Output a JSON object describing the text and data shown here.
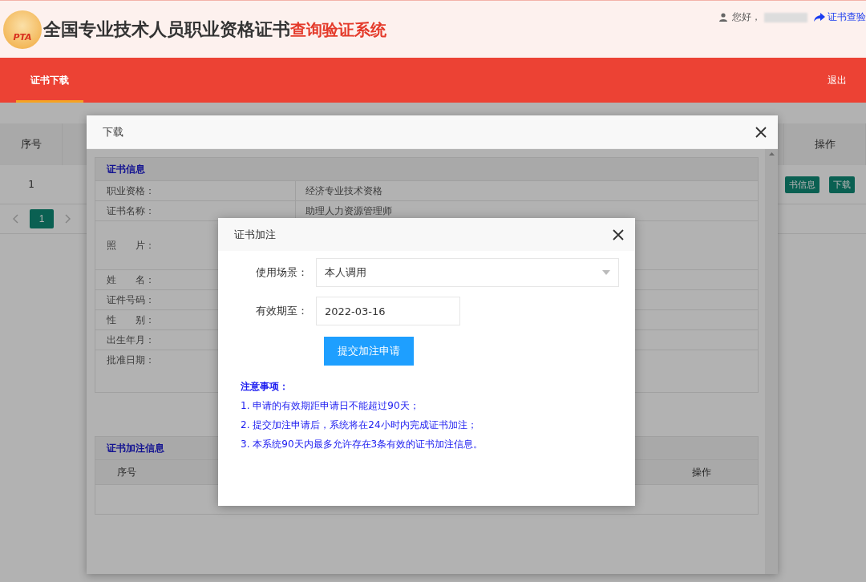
{
  "header": {
    "logo_text": "PTA",
    "title": "全国专业技术人员职业资格证书",
    "title_highlight": "查询验证系统",
    "greeting": "您好，",
    "link": "证书查验"
  },
  "nav": {
    "tabs": [
      {
        "label": "证书下载",
        "selected": true
      }
    ],
    "logout": "退出"
  },
  "table": {
    "columns": [
      "序号",
      "操作"
    ],
    "rows": [
      {
        "index": "1",
        "actions": [
          "书信息",
          "下载"
        ]
      }
    ],
    "pages": [
      {
        "label": "1",
        "selected": true
      }
    ]
  },
  "download_dialog": {
    "title": "下载",
    "info_section": {
      "title": "证书信息",
      "fields": [
        {
          "label": "职业资格：",
          "value": "经济专业技术资格",
          "kind": "text"
        },
        {
          "label": "证书名称：",
          "value": "助理人力资源管理师",
          "kind": "text"
        },
        {
          "label": "照　　片：",
          "kind": "photo"
        },
        {
          "label": "姓　　名：",
          "kind": "text"
        },
        {
          "label": "证件号码：",
          "kind": "text"
        },
        {
          "label": "性　　别：",
          "kind": "text"
        },
        {
          "label": "出生年月：",
          "kind": "text"
        },
        {
          "label": "批准日期：",
          "kind": "text"
        }
      ]
    },
    "annotation_section": {
      "title": "证书加注信息",
      "columns": [
        "序号",
        "操作"
      ]
    }
  },
  "annotation_dialog": {
    "title": "证书加注",
    "fields": [
      {
        "kind": "select",
        "label": "使用场景：",
        "value": "本人调用"
      },
      {
        "kind": "input",
        "label": "有效期至：",
        "value": "2022-03-16"
      }
    ],
    "submit": "提交加注申请",
    "notes": {
      "title": "注意事项：",
      "items": [
        "1. 申请的有效期距申请日不能超过90天；",
        "2. 提交加注申请后，系统将在24小时内完成证书加注；",
        "3. 本系统90天内最多允许存在3条有效的证书加注信息。"
      ]
    }
  }
}
